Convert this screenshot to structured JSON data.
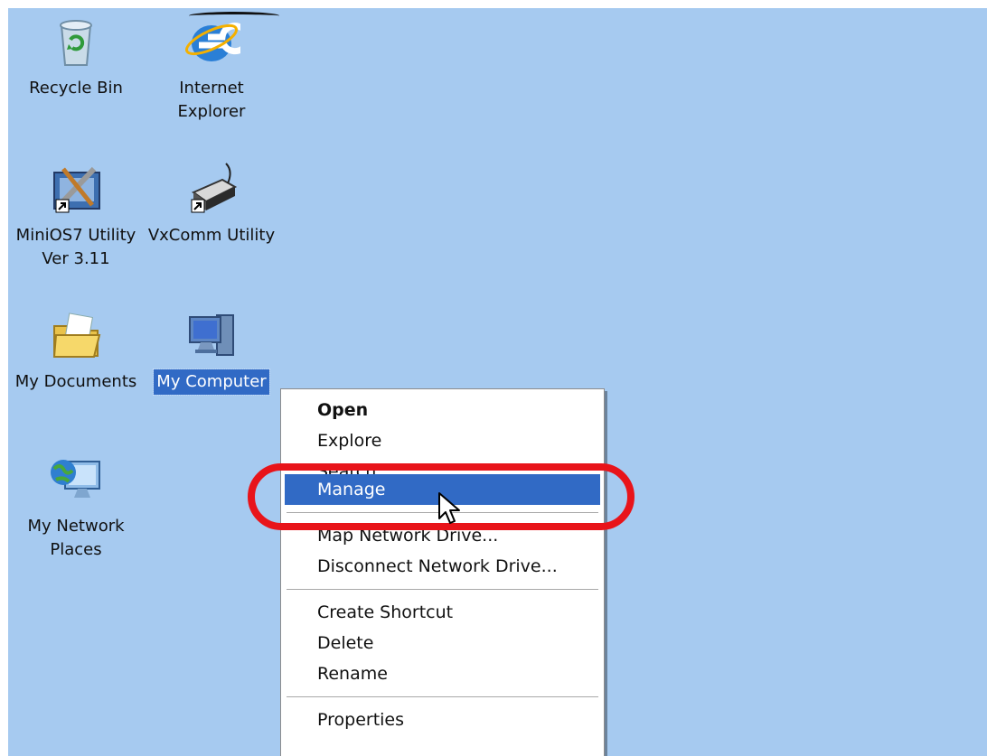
{
  "desktop": {
    "background_color": "#a6caf0",
    "icons": [
      {
        "label": "Recycle Bin",
        "icon": "recycle-bin-icon"
      },
      {
        "label": "Internet\nExplorer",
        "icon": "internet-explorer-icon"
      },
      {
        "label": "MiniOS7 Utility\nVer 3.11",
        "icon": "minios7-utility-icon",
        "shortcut": true
      },
      {
        "label": "VxComm Utility",
        "icon": "vxcomm-utility-icon",
        "shortcut": true
      },
      {
        "label": "My Documents",
        "icon": "my-documents-icon"
      },
      {
        "label": "My Computer",
        "icon": "my-computer-icon",
        "selected": true
      },
      {
        "label": "My Network\nPlaces",
        "icon": "my-network-places-icon"
      }
    ]
  },
  "context_menu": {
    "items": {
      "open": "Open",
      "explore": "Explore",
      "search": "Search",
      "manage": "Manage",
      "map_network_drive": "Map Network Drive...",
      "disconnect_network_drive": "Disconnect Network Drive...",
      "create_shortcut": "Create Shortcut",
      "delete": "Delete",
      "rename": "Rename",
      "properties": "Properties"
    },
    "hovered_item": "Manage",
    "selection_color": "#316ac5"
  },
  "annotation": {
    "color": "#e8141a",
    "target": "Manage"
  }
}
